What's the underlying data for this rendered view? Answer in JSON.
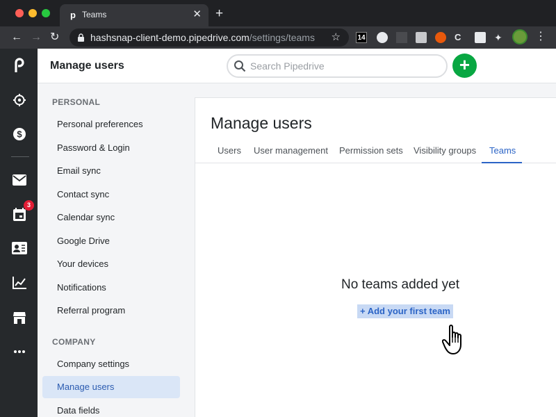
{
  "browser": {
    "tab_title": "Teams",
    "tab_favicon": "p",
    "url_host": "hashsnap-client-demo.pipedrive.com",
    "url_path": "/settings/teams",
    "extension_badge": "14"
  },
  "rail": {
    "calendar_badge": "3",
    "icons": [
      "pipedrive-logo-icon",
      "target-icon",
      "dollar-icon",
      "mail-icon",
      "calendar-icon",
      "contacts-icon",
      "chart-icon",
      "marketplace-icon",
      "more-icon"
    ]
  },
  "topbar": {
    "title": "Manage users",
    "search_placeholder": "Search Pipedrive",
    "add_label": "+"
  },
  "settings_nav": {
    "personal_title": "PERSONAL",
    "personal_items": [
      {
        "label": "Personal preferences"
      },
      {
        "label": "Password & Login"
      },
      {
        "label": "Email sync"
      },
      {
        "label": "Contact sync"
      },
      {
        "label": "Calendar sync"
      },
      {
        "label": "Google Drive"
      },
      {
        "label": "Your devices"
      },
      {
        "label": "Notifications"
      },
      {
        "label": "Referral program"
      }
    ],
    "company_title": "COMPANY",
    "company_items": [
      {
        "label": "Company settings"
      },
      {
        "label": "Manage users",
        "active": true
      },
      {
        "label": "Data fields"
      }
    ]
  },
  "content": {
    "title": "Manage users",
    "tabs": [
      {
        "label": "Users"
      },
      {
        "label": "User management"
      },
      {
        "label": "Permission sets"
      },
      {
        "label": "Visibility groups"
      },
      {
        "label": "Teams",
        "active": true
      }
    ],
    "empty_title": "No teams added yet",
    "add_team_link": "+ Add your first team"
  },
  "colors": {
    "accent": "#2b64c6",
    "add_button": "#08a742",
    "rail_bg": "#26292c",
    "badge": "#e21d35"
  }
}
